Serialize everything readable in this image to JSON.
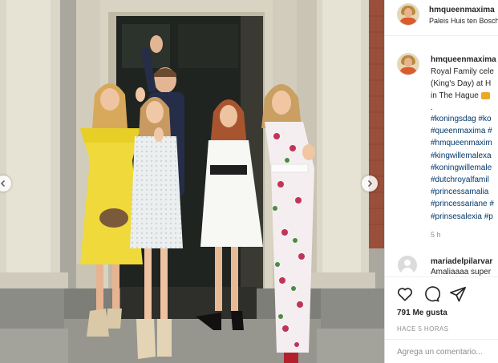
{
  "header": {
    "username": "hmqueenmaxima",
    "location": "Paleis Huis ten Bosch"
  },
  "caption": {
    "username": "hmqueenmaxima",
    "lines": [
      "Royal Family cele",
      "(King's Day) at H",
      "in The Hague"
    ],
    "dot": ".",
    "hashtags": [
      "#koningsdag #ko",
      "#queenmaxima #",
      "#hmqueenmaxim",
      "#kingwillemalexa",
      "#koningwillemale",
      "#dutchroyalfamil",
      "#princessamalia",
      "#princessariane #",
      "#prinsesalexia #p"
    ],
    "time_ago": "5 h"
  },
  "comment": {
    "username": "mariadelpilarvar",
    "text": "Amaliaaaa super"
  },
  "actions": {
    "like_icon": "heart-icon",
    "comment_icon": "comment-bubble-icon",
    "share_icon": "paper-plane-icon",
    "likes_text": "791 Me gusta",
    "date_text": "HACE 5 HORAS",
    "add_comment_placeholder": "Agrega un comentario..."
  },
  "colors": {
    "link": "#00376b",
    "text": "#262626",
    "muted": "#8e8e8e",
    "border": "#dbdbdb"
  }
}
